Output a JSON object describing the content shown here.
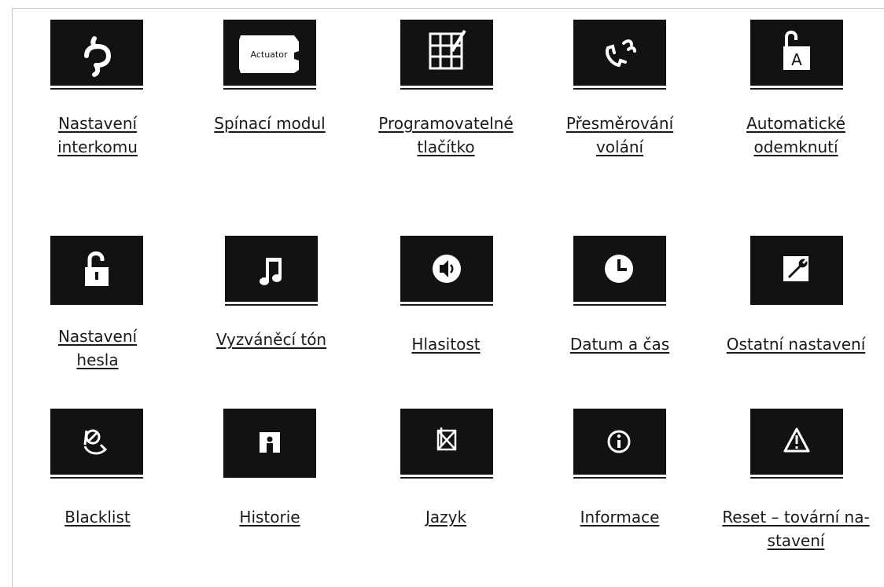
{
  "items": [
    {
      "line1": "Nastavení",
      "line2": "interkomu",
      "icon": "intercom-settings-icon"
    },
    {
      "line1": "Spínací modul",
      "line2": "",
      "icon": "actuator-icon",
      "icon_text": "Actuator"
    },
    {
      "line1": "Programovatelné",
      "line2": "tlačítko",
      "icon": "programmable-button-icon"
    },
    {
      "line1": "Přesměrování",
      "line2": "volání",
      "icon": "call-forwarding-icon"
    },
    {
      "line1": "Automatické",
      "line2": "odemknutí",
      "icon": "auto-unlock-icon",
      "icon_text": "A"
    },
    {
      "line1": "Nastavení",
      "line2": "hesla",
      "icon": "password-lock-icon"
    },
    {
      "line1": "Vyzváněcí tón",
      "line2": "",
      "icon": "ringtone-note-icon"
    },
    {
      "line1": "Hlasitost",
      "line2": "",
      "icon": "volume-speaker-icon"
    },
    {
      "line1": "Datum a čas",
      "line2": "",
      "icon": "clock-icon"
    },
    {
      "line1": "Ostatní nastavení",
      "line2": "",
      "icon": "wrench-settings-icon"
    },
    {
      "line1": "Blacklist",
      "line2": "",
      "icon": "blacklist-icon"
    },
    {
      "line1": "Historie",
      "line2": "",
      "icon": "history-icon"
    },
    {
      "line1": "Jazyk",
      "line2": "",
      "icon": "language-flag-icon"
    },
    {
      "line1": "Informace",
      "line2": "",
      "icon": "info-icon"
    },
    {
      "line1": "Reset – tovární na-",
      "line2": "stavení",
      "icon": "warning-reset-icon"
    }
  ]
}
